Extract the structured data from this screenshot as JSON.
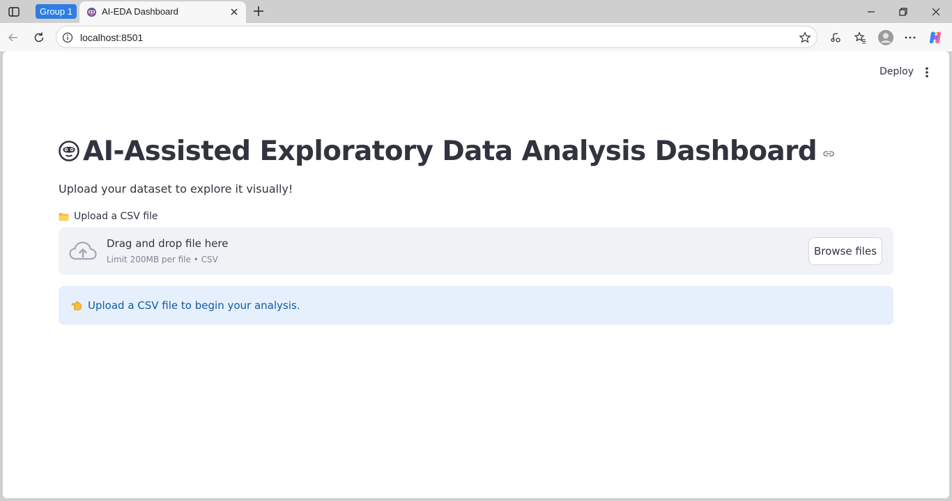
{
  "browser": {
    "tab_group_label": "Group 1",
    "tab_title": "AI-EDA Dashboard",
    "url": "localhost:8501"
  },
  "header": {
    "deploy_label": "Deploy"
  },
  "main": {
    "title": "AI-Assisted Exploratory Data Analysis Dashboard",
    "subtitle": "Upload your dataset to explore it visually!",
    "uploader": {
      "label": "Upload a CSV file",
      "drop_text": "Drag and drop file here",
      "limit_text": "Limit 200MB per file • CSV",
      "browse_label": "Browse files"
    },
    "info_message": "Upload a CSV file to begin your analysis."
  },
  "icons": {
    "title_emoji": "face-emoji-icon",
    "label_emoji": "folder-icon",
    "info_emoji": "pointing-hand-icon"
  },
  "colors": {
    "accent_blue": "#2e7de0",
    "text": "#31333f",
    "dropzone_bg": "#f0f2f6",
    "info_bg": "#e6f0fc",
    "info_text": "#0e5ba3"
  }
}
